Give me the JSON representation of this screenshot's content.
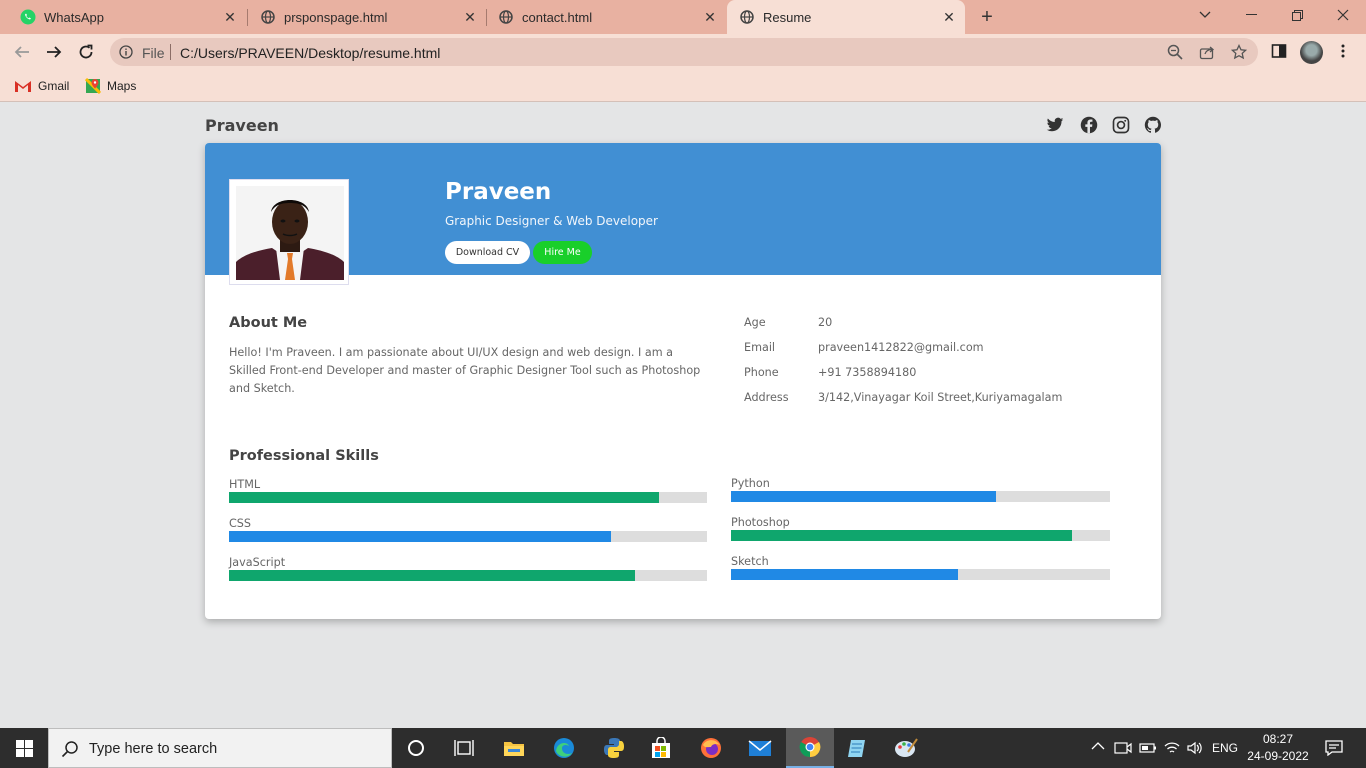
{
  "browser": {
    "tabs": [
      {
        "title": "WhatsApp",
        "icon": "whatsapp-icon",
        "active": false
      },
      {
        "title": "prsponspage.html",
        "icon": "globe-icon",
        "active": false
      },
      {
        "title": "contact.html",
        "icon": "globe-icon",
        "active": false
      },
      {
        "title": "Resume",
        "icon": "globe-icon",
        "active": true
      }
    ],
    "omnibox": {
      "scheme_label": "File",
      "url": "C:/Users/PRAVEEN/Desktop/resume.html"
    },
    "bookmarks": [
      {
        "label": "Gmail",
        "icon": "gmail-icon"
      },
      {
        "label": "Maps",
        "icon": "maps-icon"
      }
    ],
    "colors": {
      "frame": "#e8b1a1",
      "toolbar": "#f7dfd5"
    }
  },
  "page": {
    "brand": "Praveen",
    "social_icons": [
      "twitter-icon",
      "facebook-icon",
      "instagram-icon",
      "github-icon"
    ],
    "hero": {
      "name": "Praveen",
      "role": "Graphic Designer & Web Developer",
      "download_label": "Download CV",
      "hire_label": "Hire Me"
    },
    "about": {
      "title": "About Me",
      "text": "Hello! I'm Praveen. I am passionate about UI/UX design and web design. I am a Skilled Front-end Developer and master of Graphic Designer Tool such as Photoshop and Sketch."
    },
    "info": [
      {
        "label": "Age",
        "value": "20"
      },
      {
        "label": "Email",
        "value": "praveen1412822@gmail.com"
      },
      {
        "label": "Phone",
        "value": "+91 7358894180"
      },
      {
        "label": "Address",
        "value": "3/142,Vinayagar Koil Street,Kuriyamagalam"
      }
    ],
    "skills_title": "Professional Skills",
    "skills_left": [
      {
        "name": "HTML",
        "level": 0.9,
        "color": "#0fa66d"
      },
      {
        "name": "CSS",
        "level": 0.8,
        "color": "#2089e5"
      },
      {
        "name": "JavaScript",
        "level": 0.85,
        "color": "#0fa66d"
      }
    ],
    "skills_right": [
      {
        "name": "Python",
        "level": 0.7,
        "color": "#2089e5"
      },
      {
        "name": "Photoshop",
        "level": 0.9,
        "color": "#0fa66d"
      },
      {
        "name": "Sketch",
        "level": 0.6,
        "color": "#2089e5"
      }
    ],
    "colors": {
      "banner": "#418fd3",
      "hire": "#19cf2a"
    }
  },
  "taskbar": {
    "search_placeholder": "Type here to search",
    "apps": [
      "cortana-icon",
      "task-view-icon",
      "file-explorer-icon",
      "edge-icon",
      "python-icon",
      "store-icon",
      "firefox-icon",
      "mail-icon",
      "chrome-icon",
      "notepad-icon",
      "paint-icon"
    ],
    "language": "ENG",
    "time": "08:27",
    "date": "24-09-2022"
  }
}
